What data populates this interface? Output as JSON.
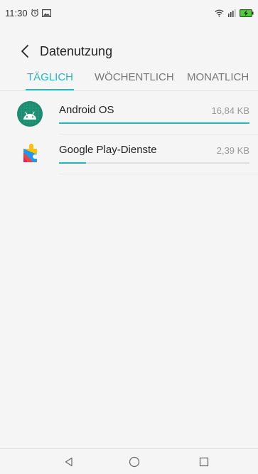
{
  "status_bar": {
    "time": "11:30",
    "icons": [
      "alarm-icon",
      "image-notification-icon",
      "wifi-icon",
      "signal-icon",
      "battery-charging-icon"
    ]
  },
  "header": {
    "back_icon": "chevron-left-icon",
    "title": "Datenutzung"
  },
  "tabs": [
    {
      "label": "TÄGLICH",
      "active": true
    },
    {
      "label": "WÖCHENTLICH",
      "active": false
    },
    {
      "label": "MONATLICH",
      "active": false
    }
  ],
  "apps": [
    {
      "name": "Android OS",
      "size": "16,84 KB",
      "usage_fraction": 1.0,
      "icon": "android-icon"
    },
    {
      "name": "Google Play-Dienste",
      "size": "2,39 KB",
      "usage_fraction": 0.14,
      "icon": "google-play-services-icon"
    }
  ],
  "colors": {
    "accent": "#1fb8c4",
    "background": "#f5f5f5"
  },
  "nav_bar": {
    "icons": [
      "back-triangle-icon",
      "home-circle-icon",
      "recents-square-icon"
    ]
  }
}
